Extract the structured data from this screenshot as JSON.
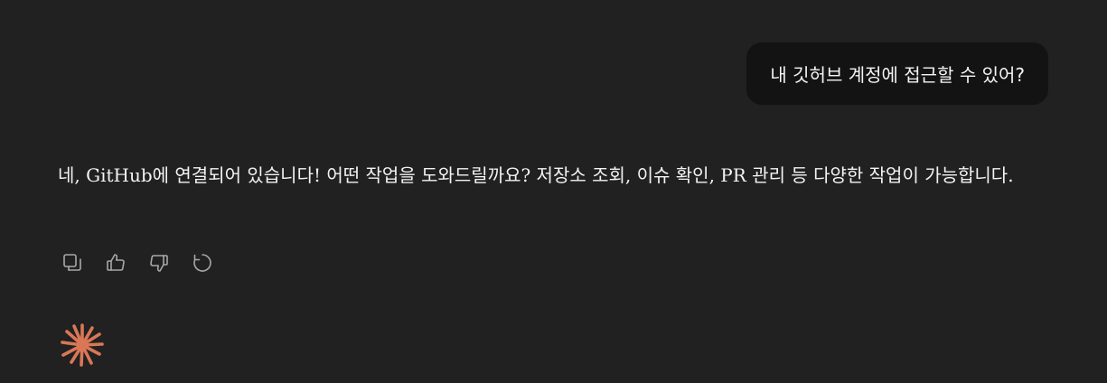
{
  "conversation": {
    "user_message": "내 깃허브 계정에 접근할 수 있어?",
    "assistant_message": "네, GitHub에 연결되어 있습니다! 어떤 작업을 도와드릴까요? 저장소 조회, 이슈 확인, PR 관리 등 다양한 작업이 가능합니다."
  },
  "actions": [
    {
      "name": "copy",
      "icon": "copy-icon"
    },
    {
      "name": "thumbs-up",
      "icon": "thumbs-up-icon"
    },
    {
      "name": "thumbs-down",
      "icon": "thumbs-down-icon"
    },
    {
      "name": "retry",
      "icon": "retry-icon"
    }
  ],
  "colors": {
    "background": "#212121",
    "user_bubble": "#131313",
    "text": "#f2f2f2",
    "icon": "#a8a8a8",
    "logo": "#d97757"
  }
}
